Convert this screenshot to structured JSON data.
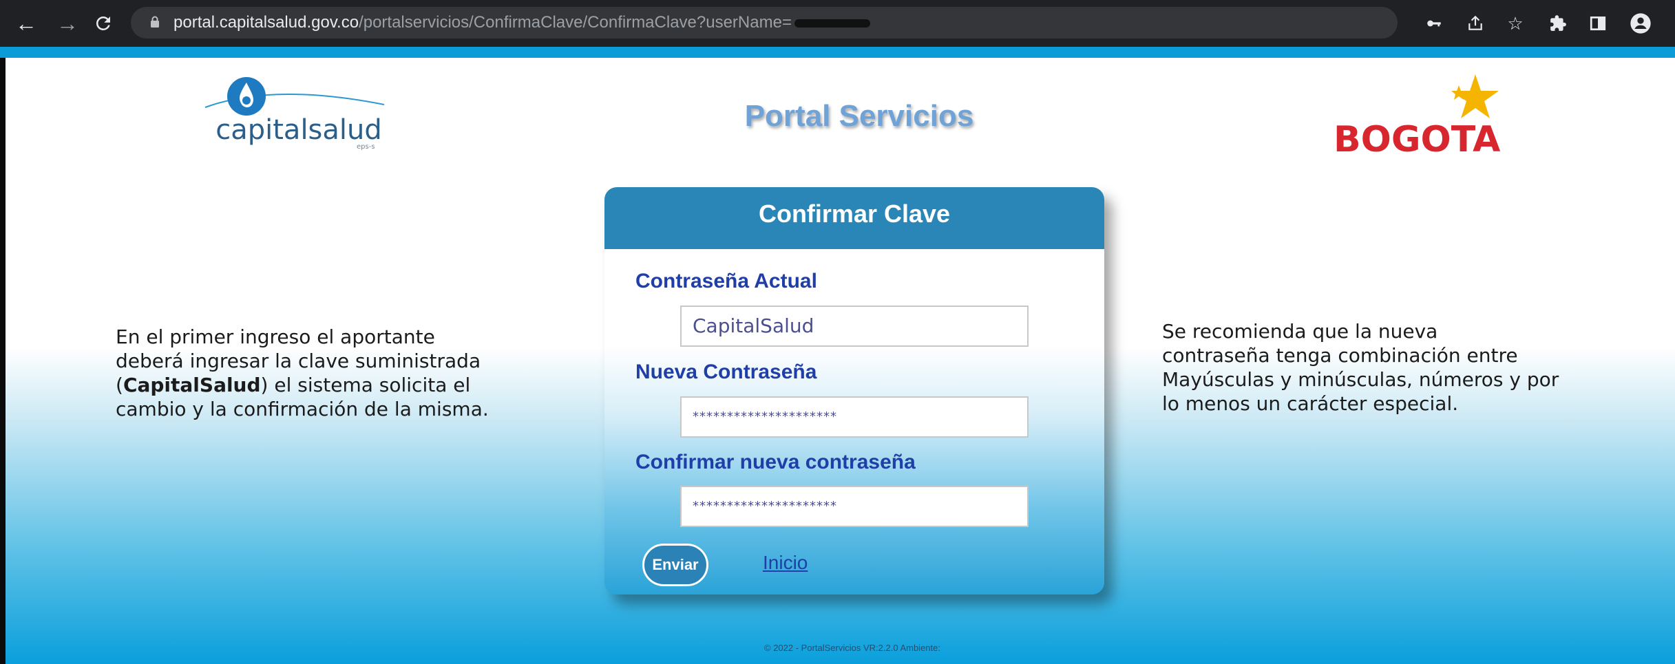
{
  "browser": {
    "url_domain": "portal.capitalsalud.gov.co",
    "url_path": "/portalservicios/ConfirmaClave/ConfirmaClave?userName=",
    "icons": [
      "back-icon",
      "forward-icon",
      "reload-icon",
      "lock-icon",
      "key-icon",
      "share-icon",
      "star-icon",
      "extensions-icon",
      "side-panel-icon",
      "profile-icon"
    ]
  },
  "header": {
    "title": "Portal Servicios",
    "logo_left_text": "capitalsalud",
    "logo_left_sub": "eps-s",
    "logo_right_text": "BOGOTA"
  },
  "left_note": {
    "line1": "En el primer ingreso el aportante",
    "line2": "deberá ingresar la clave suministrada",
    "line3_pre": "(",
    "line3_bold": "CapitalSalud",
    "line3_post": ") el sistema solicita el",
    "line4": "cambio y la confirmación de la misma."
  },
  "right_note": {
    "line1": "Se recomienda que la nueva",
    "line2": "contraseña tenga combinación entre",
    "line3": "Mayúsculas y minúsculas, números y por",
    "line4": "lo menos un carácter especial."
  },
  "form": {
    "title": "Confirmar Clave",
    "current_label": "Contraseña Actual",
    "current_value": "CapitalSalud",
    "new_label": "Nueva Contraseña",
    "new_value": "*********************",
    "confirm_label": "Confirmar nueva contraseña",
    "confirm_value": "*********************",
    "submit_label": "Enviar",
    "home_link": "Inicio"
  },
  "footer": {
    "text": "© 2022 - PortalServicios VR:2.2.0 Ambiente:"
  },
  "colors": {
    "accent": "#0b9bd7",
    "header": "#2a86b6",
    "label": "#1f3ea8",
    "bogota_red": "#d7262e",
    "bogota_star": "#f5b400"
  }
}
